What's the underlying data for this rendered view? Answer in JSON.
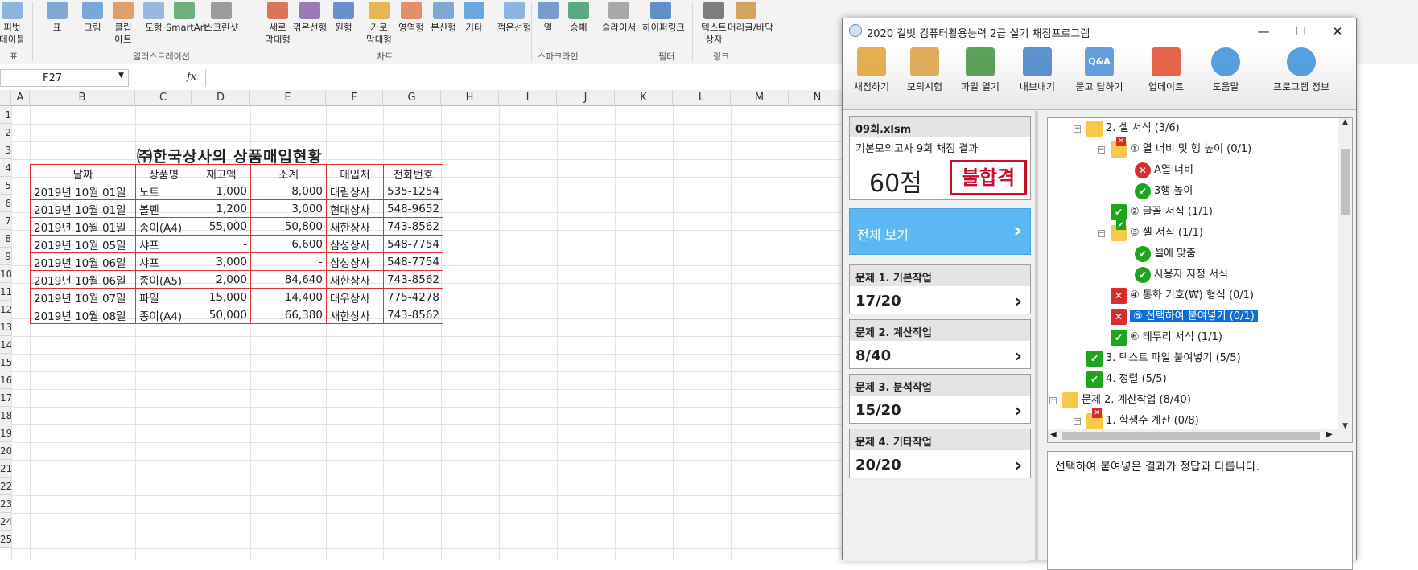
{
  "ribbon": {
    "buttons": [
      "피벗\n테이블",
      "표",
      "그림",
      "클립\n아트",
      "도형",
      "SmartArt",
      "스크린샷",
      "세로\n막대형",
      "꺾은선형",
      "원형",
      "가로\n막대형",
      "영역형",
      "분산형",
      "기타",
      "꺾은선형",
      "열",
      "승패",
      "슬라이서",
      "하이퍼링크",
      "텍스트\n상자",
      "머리글/바닥"
    ],
    "groups": [
      "표",
      "일러스트레이션",
      "차트",
      "스파크라인",
      "필터",
      "링크"
    ]
  },
  "formula_bar": {
    "name_box": "F27",
    "fx": "fx",
    "value": ""
  },
  "columns": [
    "A",
    "B",
    "C",
    "D",
    "E",
    "F",
    "G",
    "H",
    "I",
    "J",
    "K",
    "L",
    "M",
    "N"
  ],
  "rows": [
    "1",
    "2",
    "3",
    "4",
    "5",
    "6",
    "7",
    "8",
    "9",
    "10",
    "11",
    "12",
    "13",
    "14",
    "15",
    "16",
    "17",
    "18",
    "19",
    "20",
    "21",
    "22",
    "23",
    "24",
    "25"
  ],
  "sheet": {
    "title": "㈜한국상사의  상품매입현황",
    "headers": [
      "날짜",
      "상품명",
      "재고액",
      "소계",
      "매입처",
      "전화번호"
    ],
    "rows": [
      [
        "2019년 10월 01일",
        "노트",
        "1,000",
        "8,000",
        "대림상사",
        "535-1254"
      ],
      [
        "2019년 10월 01일",
        "볼펜",
        "1,200",
        "3,000",
        "현대상사",
        "548-9652"
      ],
      [
        "2019년 10월 01일",
        "종이(A4)",
        "55,000",
        "50,800",
        "새한상사",
        "743-8562"
      ],
      [
        "2019년 10월 05일",
        "샤프",
        "-",
        "6,600",
        "삼성상사",
        "548-7754"
      ],
      [
        "2019년 10월 06일",
        "샤프",
        "3,000",
        "-",
        "삼성상사",
        "548-7754"
      ],
      [
        "2019년 10월 06일",
        "종이(A5)",
        "2,000",
        "84,640",
        "새한상사",
        "743-8562"
      ],
      [
        "2019년 10월 07일",
        "파일",
        "15,000",
        "14,400",
        "대우상사",
        "775-4278"
      ],
      [
        "2019년 10월 08일",
        "종이(A4)",
        "50,000",
        "66,380",
        "새한상사",
        "743-8562"
      ]
    ]
  },
  "grader": {
    "window_title": "2020 길벗 컴퓨터활용능력 2급 실기 채점프로그램",
    "window_buttons": [
      "—",
      "☐",
      "✕"
    ],
    "toolbar": [
      "채점하기",
      "모의시험",
      "파일 열기",
      "내보내기",
      "묻고 답하기",
      "업데이트",
      "도움말",
      "프로그램 정보"
    ],
    "toolbar_qa": "Q&A",
    "file_name": "09회.xlsm",
    "result_title": "기본모의고사 9회 채점 결과",
    "score": "60점",
    "stamp": "불합격",
    "view_all": "전체 보기",
    "problems": [
      {
        "label": "문제 1. 기본작업",
        "score": "17/20"
      },
      {
        "label": "문제 2. 계산작업",
        "score": "8/40"
      },
      {
        "label": "문제 3. 분석작업",
        "score": "15/20"
      },
      {
        "label": "문제 4. 기타작업",
        "score": "20/20"
      }
    ],
    "tree": [
      {
        "text": "2. 셀 서식 (3/6)",
        "icon": "folder",
        "indent": 0
      },
      {
        "text": "① 열 너비 및 행 높이 (0/1)",
        "icon": "ng-folder",
        "indent": 1
      },
      {
        "text": "A열 너비",
        "icon": "ngc",
        "indent": 2
      },
      {
        "text": "3행 높이",
        "icon": "okc",
        "indent": 2
      },
      {
        "text": "② 글꼴 서식 (1/1)",
        "icon": "ok",
        "indent": 1
      },
      {
        "text": "③ 셀 서식 (1/1)",
        "icon": "ok-folder",
        "indent": 1
      },
      {
        "text": "셀에 맞춤",
        "icon": "okc",
        "indent": 2
      },
      {
        "text": "사용자 지정 서식",
        "icon": "okc",
        "indent": 2
      },
      {
        "text": "④ 통화 기호(₩) 형식 (0/1)",
        "icon": "ng",
        "indent": 1
      },
      {
        "text": "⑤ 선택하여 붙여넣기 (0/1)",
        "icon": "ng",
        "indent": 1,
        "selected": true
      },
      {
        "text": "⑥ 테두리 서식 (1/1)",
        "icon": "ok",
        "indent": 1
      },
      {
        "text": "3. 텍스트 파일 붙여넣기 (5/5)",
        "icon": "ok",
        "indent": 0
      },
      {
        "text": "4. 정렬 (5/5)",
        "icon": "ok",
        "indent": 0
      },
      {
        "text": "문제 2. 계산작업 (8/40)",
        "icon": "folder",
        "indent": -1
      },
      {
        "text": "1. 학생수 계산 (0/8)",
        "icon": "ng-folder",
        "indent": 0
      }
    ],
    "message": "선택하여 붙여넣은 결과가 정답과 다릅니다.",
    "colors": {
      "accent": "#5cb8f2",
      "selected": "#0a6fd6",
      "ok": "#1ea51e",
      "ng": "#d92c2c"
    }
  }
}
